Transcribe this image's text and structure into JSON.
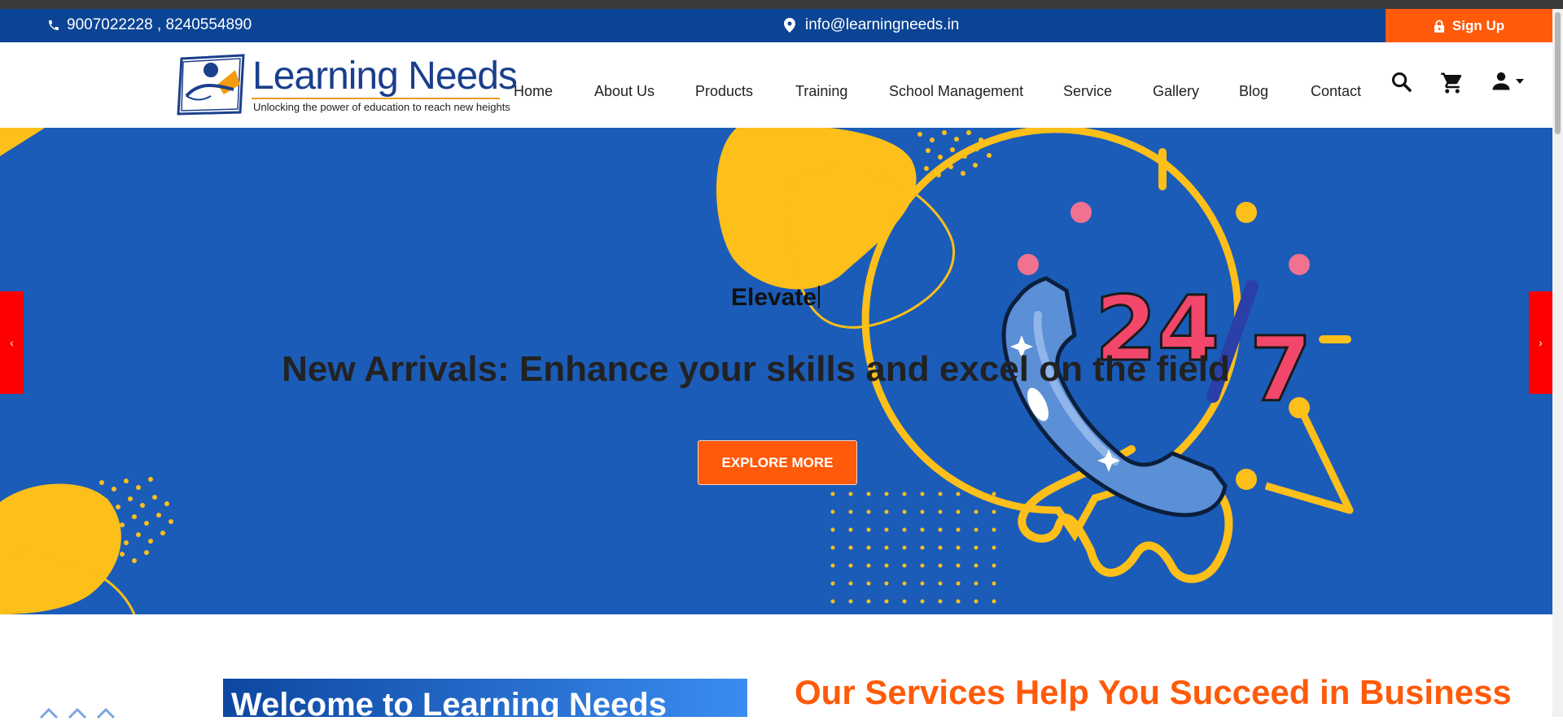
{
  "topbar": {
    "phones": "9007022228 , 8240554890",
    "email": "info@learningneeds.in",
    "signup_label": "Sign Up"
  },
  "logo": {
    "title": "Learning Needs",
    "tagline": "Unlocking the power of education to reach new heights"
  },
  "nav": {
    "items": [
      "Home",
      "About Us",
      "Products",
      "Training",
      "School Management",
      "Service",
      "Gallery",
      "Blog",
      "Contact"
    ]
  },
  "icons": {
    "search": "search-icon",
    "cart": "cart-icon",
    "account": "account-icon"
  },
  "hero": {
    "label": "Elevate",
    "title": "New Arrivals: Enhance your skills and excel on the field",
    "button": "EXPLORE MORE",
    "prev": "‹",
    "next": "›",
    "art_text_1": "24",
    "art_text_2": "7"
  },
  "sections": {
    "welcome": "Welcome to Learning Needs",
    "services": "Our Services Help You Succeed in Business"
  },
  "colors": {
    "topbar": "#0b4494",
    "accent": "#ff5a0a",
    "hero_bg": "#1b5cb8",
    "yellow": "#fdbf19"
  }
}
